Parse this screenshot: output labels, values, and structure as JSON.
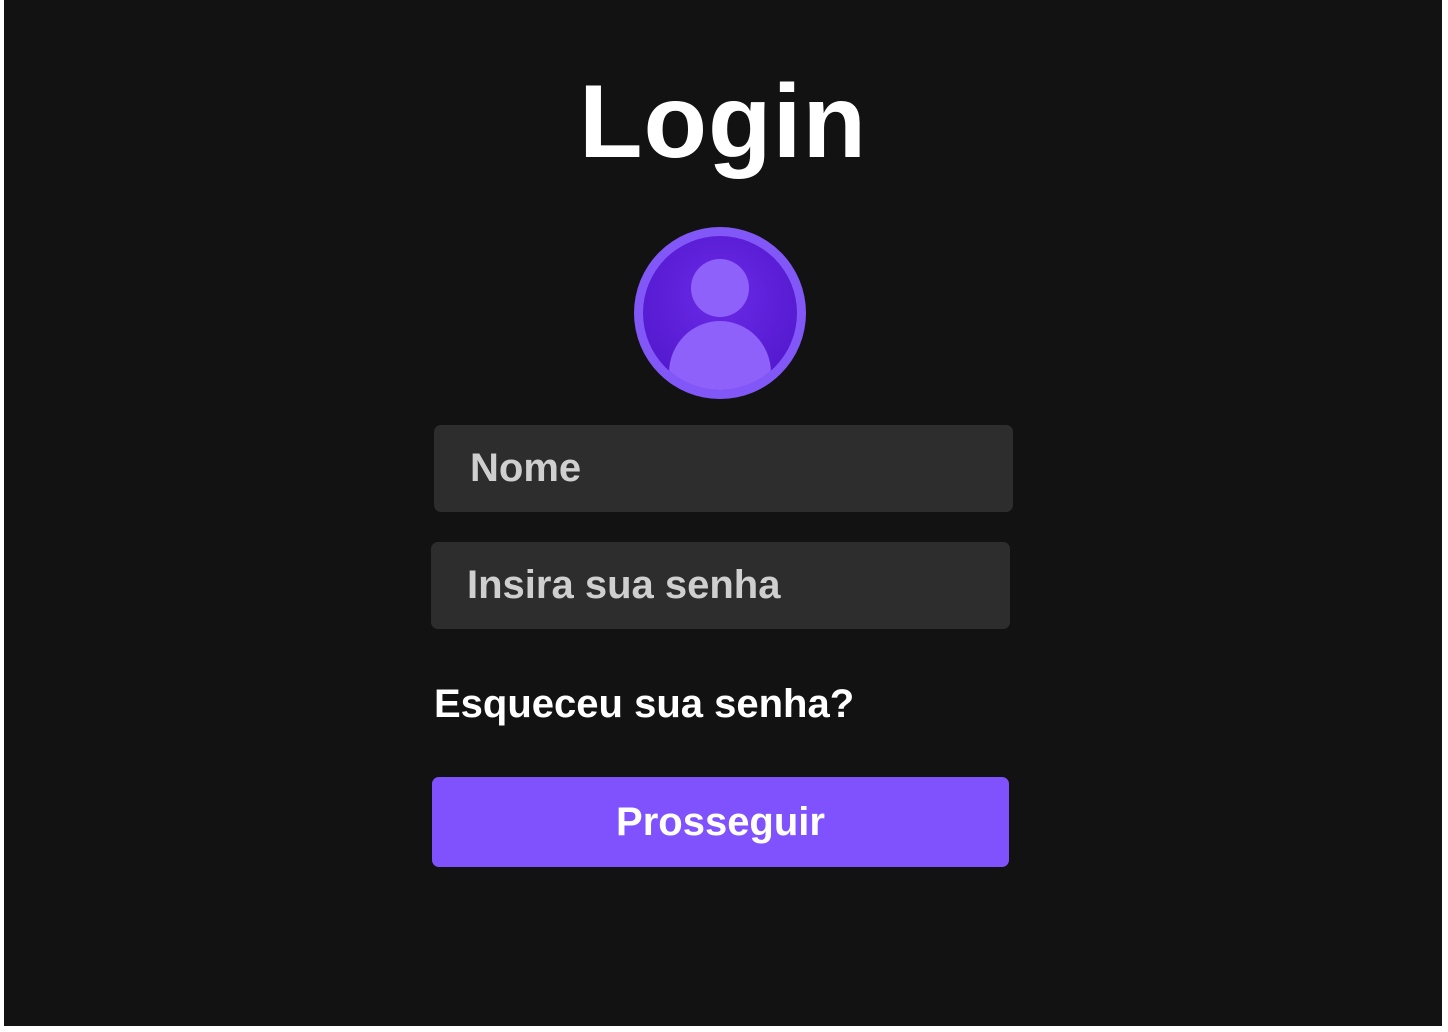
{
  "page": {
    "title": "Login"
  },
  "avatar": {
    "icon": "user-avatar-icon",
    "colors": {
      "ring": "#8257f8",
      "inner": "#5b1fd6",
      "figure": "#8e62fa"
    }
  },
  "form": {
    "name_placeholder": "Nome",
    "password_placeholder": "Insira sua senha",
    "forgot_password": "Esqueceu sua senha?",
    "submit_label": "Prosseguir"
  },
  "theme": {
    "background": "#121212",
    "field_background": "#2d2d2d",
    "accent": "#7f52fd",
    "text": "#ffffff",
    "placeholder_text": "#cfcfcf"
  }
}
